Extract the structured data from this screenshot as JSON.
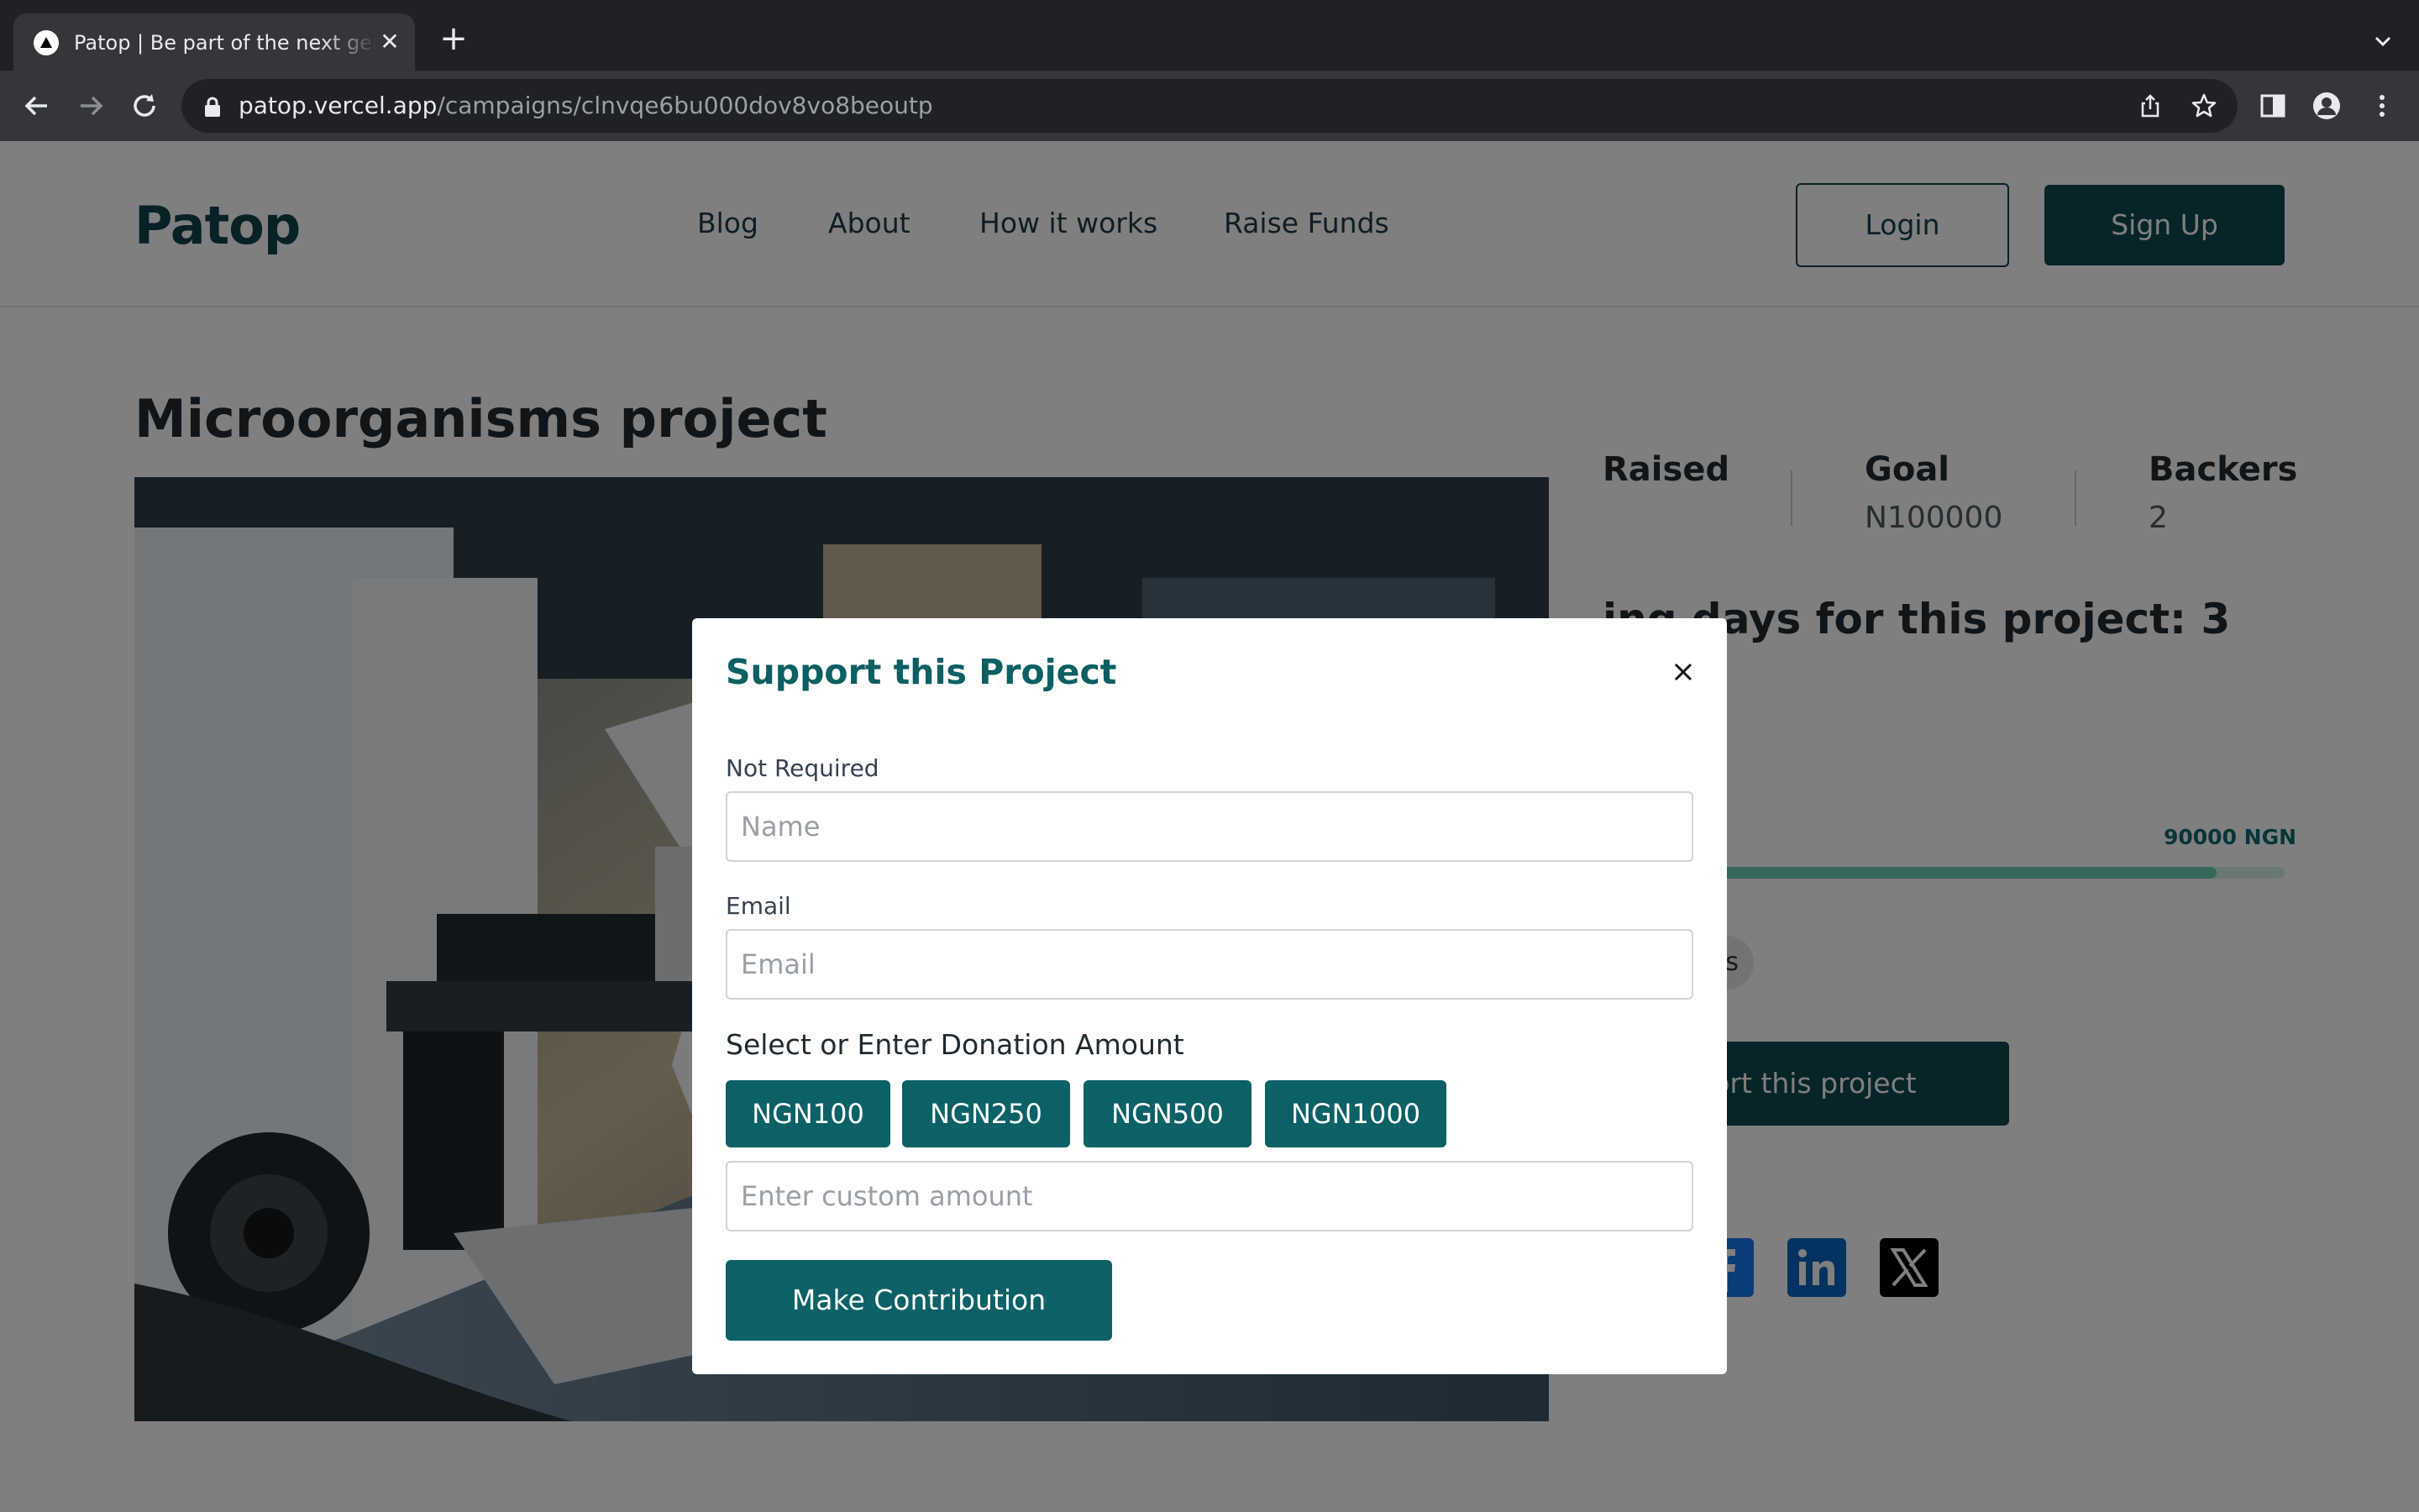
{
  "browser": {
    "tab_title": "Patop | Be part of the next generation",
    "url_host": "patop.vercel.app",
    "url_path": "/campaigns/clnvqe6bu000dov8vo8beoutp"
  },
  "site": {
    "logo": "Patop",
    "nav": [
      "Blog",
      "About",
      "How it works",
      "Raise Funds"
    ],
    "login_label": "Login",
    "signup_label": "Sign Up"
  },
  "project": {
    "title": "Microorganisms project",
    "stats": [
      {
        "label": "Raised",
        "value": ""
      },
      {
        "label": "Goal",
        "value": "N100000"
      },
      {
        "label": "Backers",
        "value": "2"
      }
    ],
    "remaining_text": "ing days for this project: 3",
    "goal_amount_label": "90000 NGN",
    "progress_fraction": 0.9,
    "chip_text": "s",
    "support_label": "port this project",
    "social": [
      {
        "icon": "instagram-icon",
        "color": "#3b3b3b"
      },
      {
        "icon": "facebook-icon",
        "color": "#1877f2"
      },
      {
        "icon": "linkedin-icon",
        "color": "#0a66c2"
      },
      {
        "icon": "x-icon",
        "color": "#000000"
      }
    ]
  },
  "modal": {
    "title": "Support this Project",
    "name_label": "Not Required",
    "name_placeholder": "Name",
    "email_label": "Email",
    "email_placeholder": "Email",
    "amount_section_label": "Select or Enter Donation Amount",
    "amount_options": [
      "NGN100",
      "NGN250",
      "NGN500",
      "NGN1000"
    ],
    "custom_amount_placeholder": "Enter custom amount",
    "submit_label": "Make Contribution"
  },
  "colors": {
    "brand_dark": "#0f4853",
    "brand_teal": "#0c6166",
    "progress": "#6fd0b8"
  }
}
